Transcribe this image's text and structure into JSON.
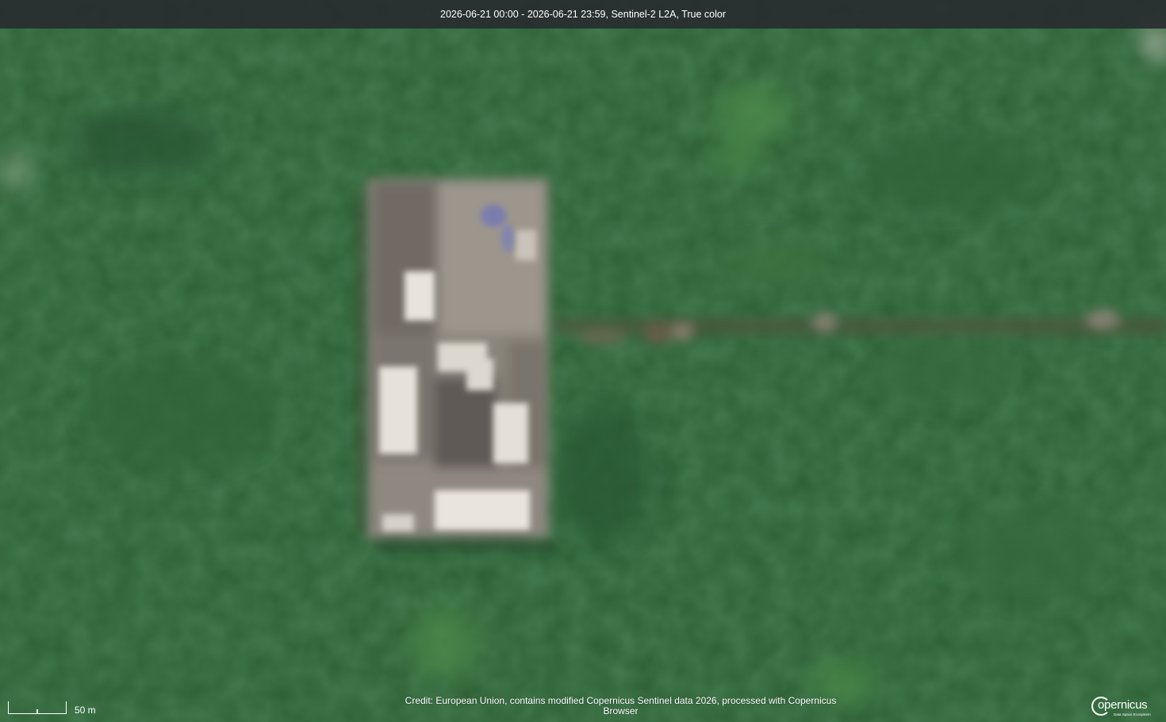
{
  "header": {
    "caption": "2026-06-21 00:00 - 2026-06-21 23:59, Sentinel-2 L2A, True color"
  },
  "scale": {
    "label": "50 m"
  },
  "credit": {
    "text": "Credit: European Union, contains modified Copernicus Sentinel data 2026, processed with Copernicus Browser"
  },
  "logo": {
    "name": "opernicus",
    "tagline": "Data Space Ecosystem"
  },
  "colors": {
    "vegetation": "#2c5e33",
    "roof": "#b3aca3",
    "header_bg": "#2c3034"
  }
}
